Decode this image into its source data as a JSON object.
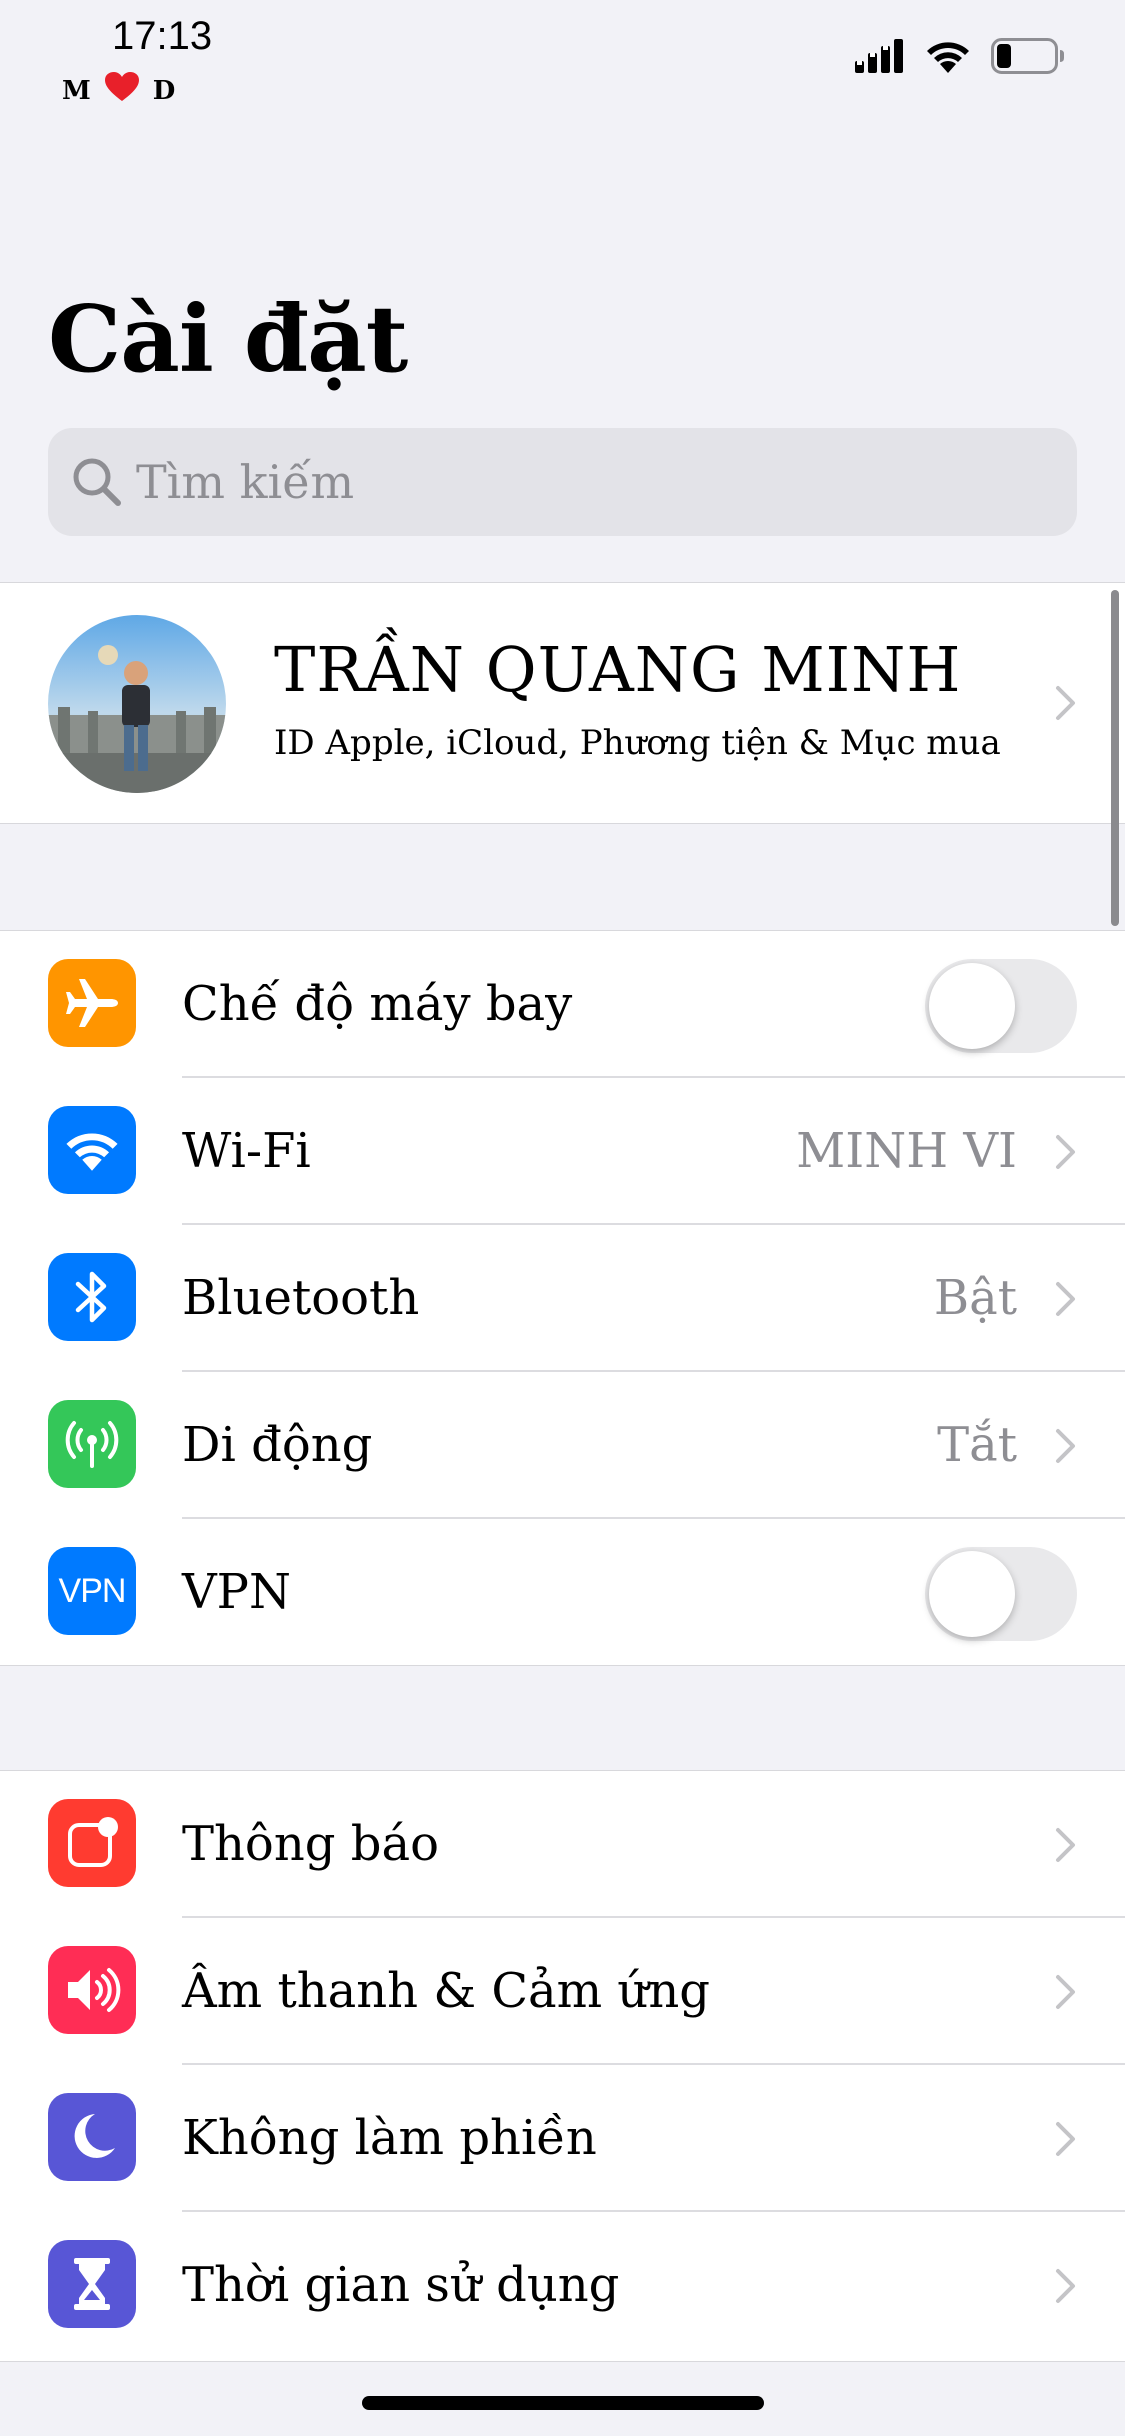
{
  "status_bar": {
    "time": "17:13",
    "carrier_left": "M",
    "carrier_right": "D",
    "heart_icon": "heart-icon",
    "signal_icon": "signal-bars-icon",
    "wifi_icon": "wifi-icon",
    "battery_icon": "battery-icon"
  },
  "header": {
    "title": "Cài đặt"
  },
  "search": {
    "placeholder": "Tìm kiếm",
    "icon": "search-icon"
  },
  "profile": {
    "name": "TRẦN QUANG MINH",
    "subtitle": "ID Apple, iCloud, Phương tiện & Mục mua"
  },
  "connectivity": [
    {
      "label": "Chế độ máy bay",
      "icon": "airplane-icon",
      "color": "#FF9500",
      "type": "toggle",
      "on": false
    },
    {
      "label": "Wi-Fi",
      "icon": "wifi-icon",
      "color": "#007AFF",
      "value": "MINH VI",
      "type": "link"
    },
    {
      "label": "Bluetooth",
      "icon": "bluetooth-icon",
      "color": "#007AFF",
      "value": "Bật",
      "type": "link"
    },
    {
      "label": "Di động",
      "icon": "cellular-antenna-icon",
      "color": "#34C759",
      "value": "Tắt",
      "type": "link"
    },
    {
      "label": "VPN",
      "icon": "vpn-icon",
      "icon_text": "VPN",
      "color": "#007AFF",
      "type": "toggle",
      "on": false
    }
  ],
  "notifications": [
    {
      "label": "Thông báo",
      "icon": "notification-icon",
      "color": "#FF3B30"
    },
    {
      "label": "Âm thanh & Cảm ứng",
      "icon": "speaker-icon",
      "color": "#FF2D55"
    },
    {
      "label": "Không làm phiền",
      "icon": "moon-icon",
      "color": "#5856D6"
    },
    {
      "label": "Thời gian sử dụng",
      "icon": "hourglass-icon",
      "color": "#5856D6"
    }
  ]
}
